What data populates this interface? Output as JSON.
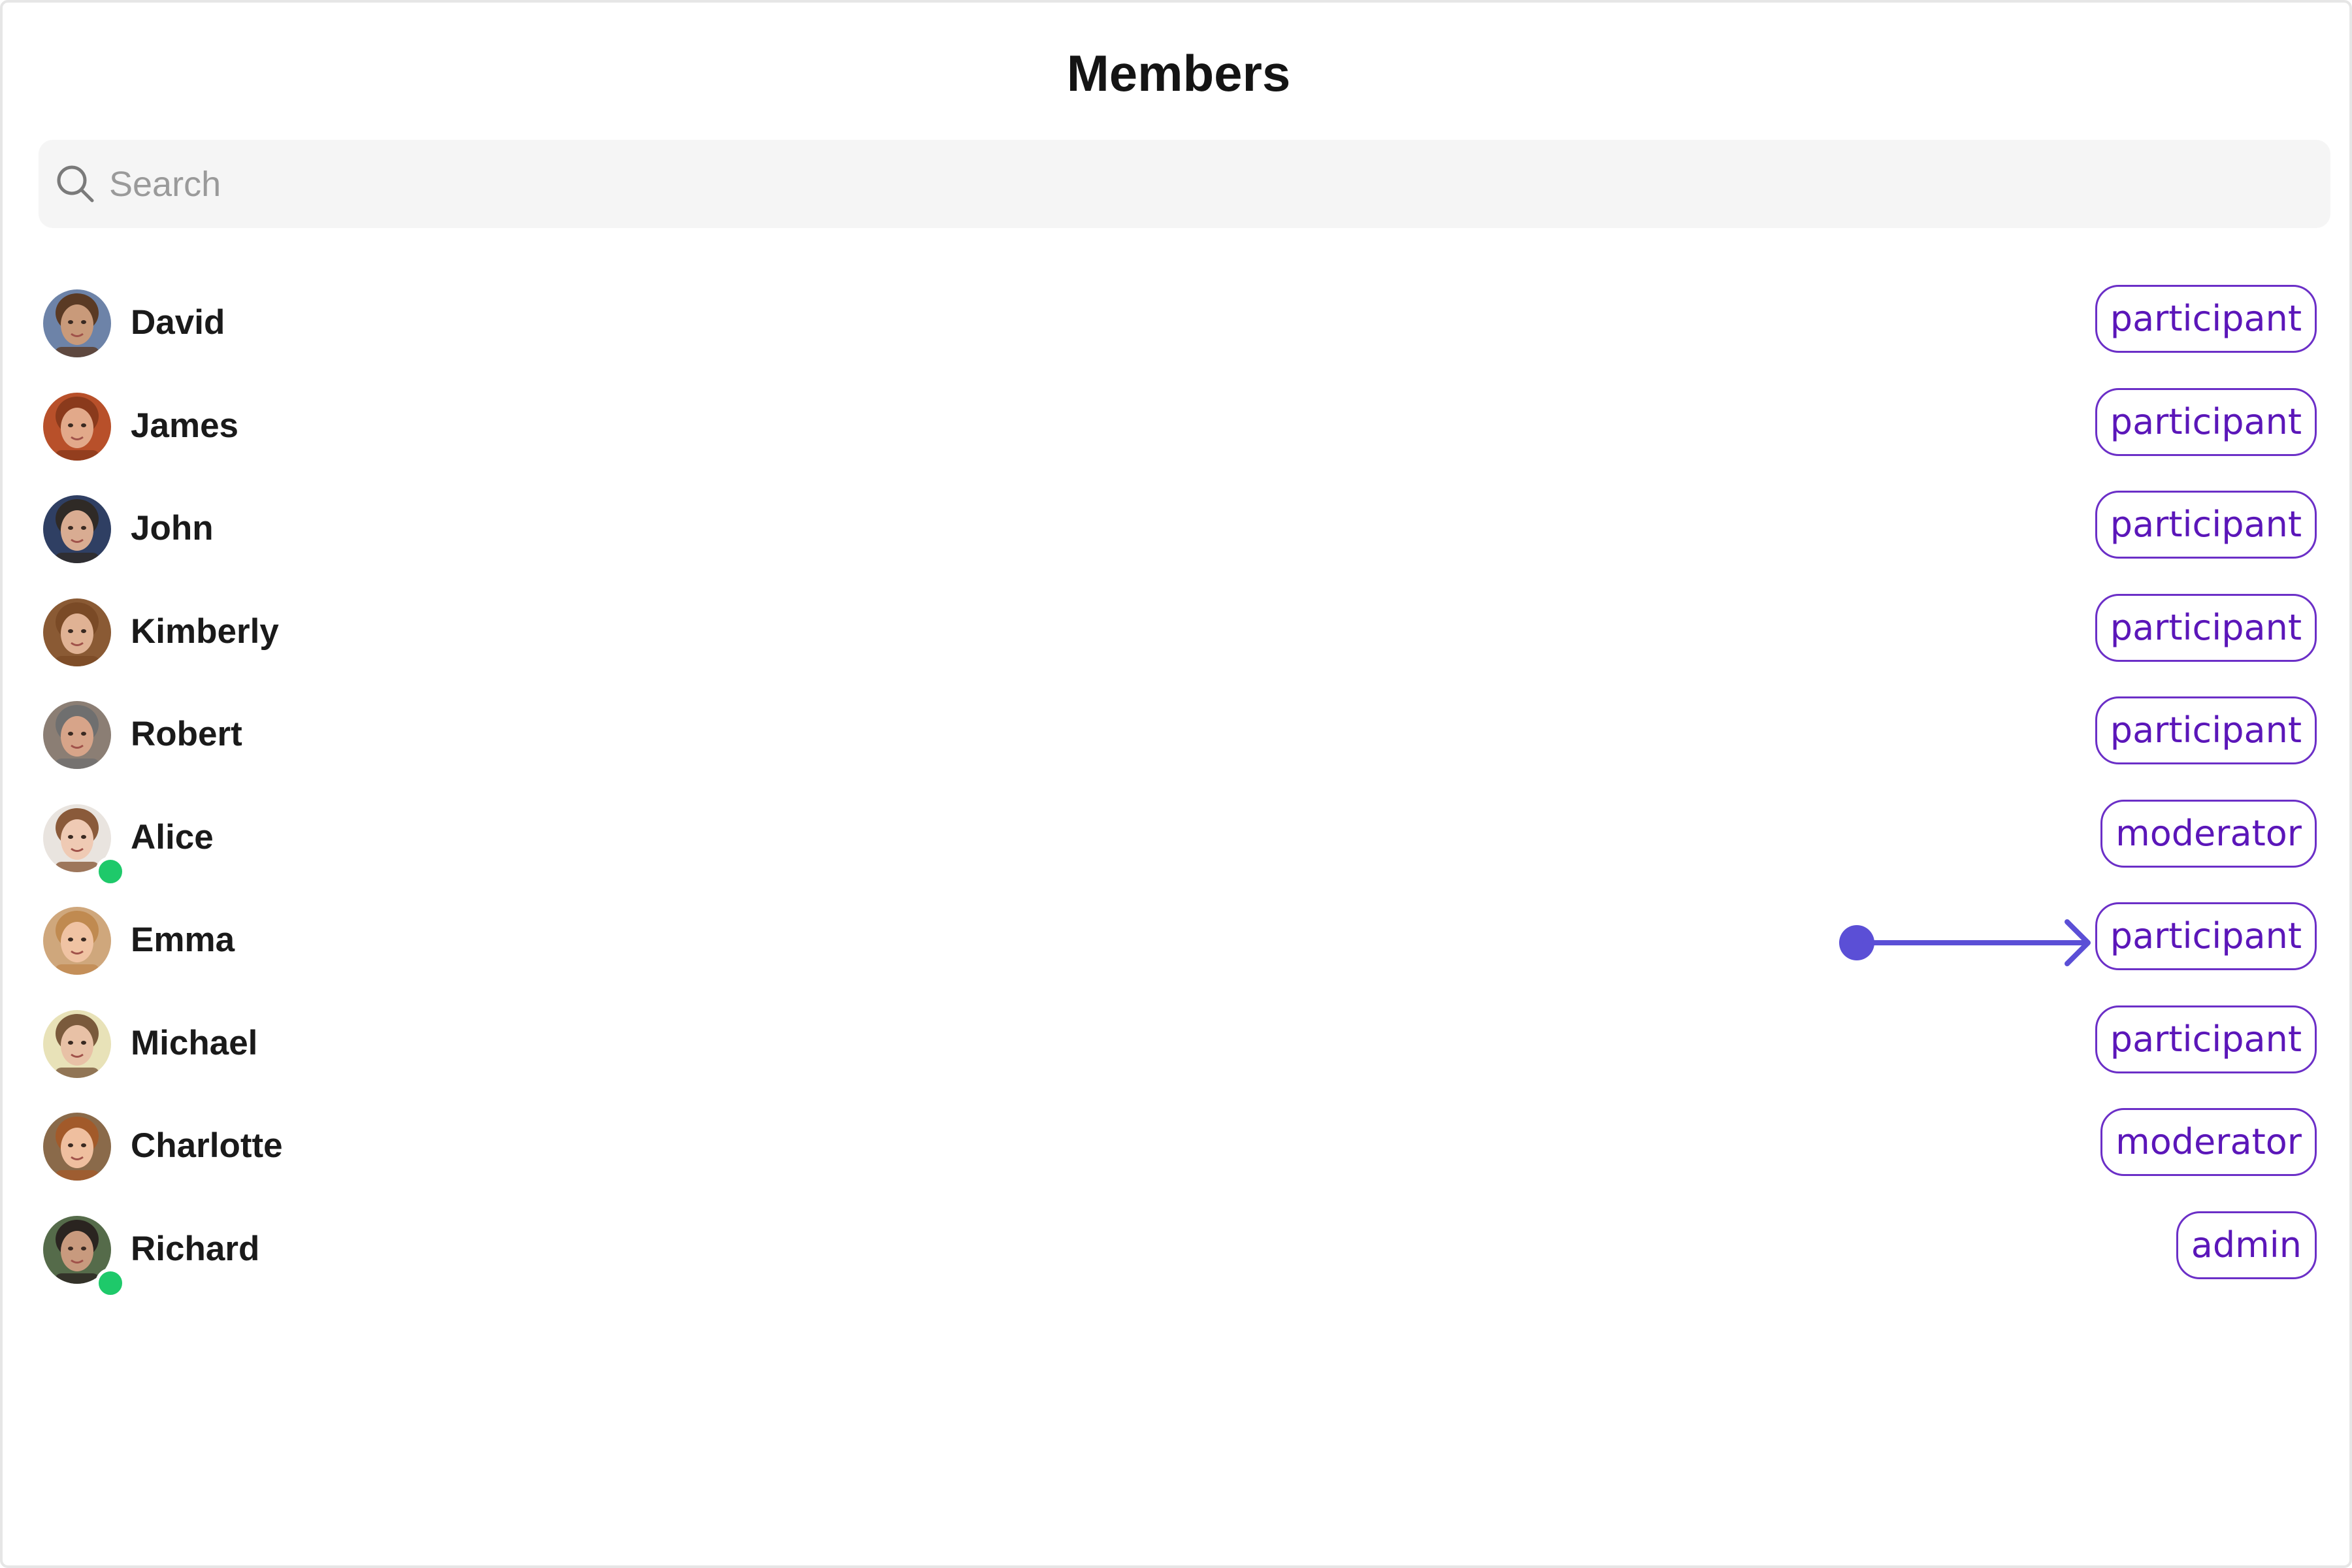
{
  "header": {
    "title": "Members"
  },
  "search": {
    "placeholder": "Search",
    "value": ""
  },
  "colors": {
    "accent": "#5b16b9",
    "badge_border": "#6b2fc7",
    "online": "#1ec96a",
    "pointer": "#5b4fd6"
  },
  "members": [
    {
      "name": "David",
      "role": "participant",
      "online": false,
      "skin": "#c99a7a",
      "hair": "#5a3a24",
      "bg": "#6d83a8"
    },
    {
      "name": "James",
      "role": "participant",
      "online": false,
      "skin": "#e2a98a",
      "hair": "#8a3a1c",
      "bg": "#b8502a"
    },
    {
      "name": "John",
      "role": "participant",
      "online": false,
      "skin": "#d9ac92",
      "hair": "#2f2a26",
      "bg": "#2f3f63"
    },
    {
      "name": "Kimberly",
      "role": "participant",
      "online": false,
      "skin": "#e0b294",
      "hair": "#7a4a26",
      "bg": "#8a5a34"
    },
    {
      "name": "Robert",
      "role": "participant",
      "online": false,
      "skin": "#d7a489",
      "hair": "#6f6f6f",
      "bg": "#8b7e74"
    },
    {
      "name": "Alice",
      "role": "moderator",
      "online": true,
      "skin": "#efcab4",
      "hair": "#8a5a3a",
      "bg": "#e9e4df"
    },
    {
      "name": "Emma",
      "role": "participant",
      "online": false,
      "skin": "#f0c3a3",
      "hair": "#c08a50",
      "bg": "#cfa77c"
    },
    {
      "name": "Michael",
      "role": "participant",
      "online": false,
      "skin": "#e8c1a6",
      "hair": "#7a5a3c",
      "bg": "#e8e2b8"
    },
    {
      "name": "Charlotte",
      "role": "moderator",
      "online": false,
      "skin": "#efbf9f",
      "hair": "#a25a2a",
      "bg": "#8a6a4a"
    },
    {
      "name": "Richard",
      "role": "admin",
      "online": true,
      "skin": "#c89a7e",
      "hair": "#2a2420",
      "bg": "#556b4a"
    }
  ]
}
